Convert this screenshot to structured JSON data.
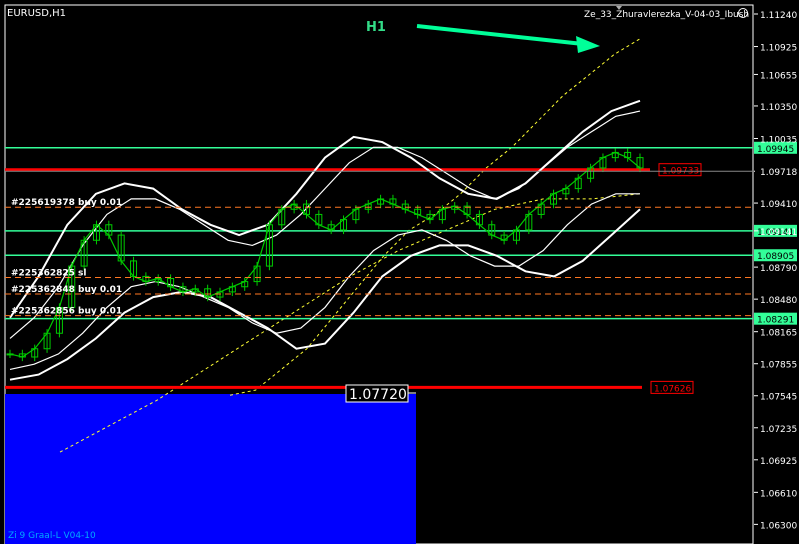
{
  "symbol_label": "EURUSD,H1",
  "indicator_title": "Ze_33_Zhuravlerezka_V-04-03_Ibush",
  "timeframe_annotation": "H1",
  "footer_label": "Zi 9 Graal-L V04-10",
  "crosshair_price": "1.07720",
  "colors": {
    "background": "#000000",
    "candle": "#00cc00",
    "green_level": "#33ff99",
    "red_level": "#ff0000",
    "envelope": "#ffffff",
    "dashed_yellow": "#ffff33",
    "blue_panel": "#0000ff",
    "arrow": "#00ff99",
    "order_line": "#ff7722"
  },
  "chart_data": {
    "type": "line",
    "title": "EURUSD,H1",
    "ylim": [
      1.0611,
      1.1124
    ],
    "y_ticks": [
      "1.11240",
      "1.10925",
      "1.10655",
      "1.10350",
      "1.10035",
      "1.09718",
      "1.09410",
      "1.09141",
      "1.08790",
      "1.08480",
      "1.08165",
      "1.07855",
      "1.07545",
      "1.07235",
      "1.06925",
      "1.06610",
      "1.06300"
    ],
    "current_price": "1.09718",
    "green_levels": [
      {
        "label": "1.09945",
        "value": 1.09945
      },
      {
        "label": "1.09141",
        "value": 1.09141
      },
      {
        "label": "1.08905",
        "value": 1.08905
      },
      {
        "label": "1.08291",
        "value": 1.08291
      }
    ],
    "red_levels": [
      {
        "label": "1.09733",
        "value": 1.09733
      },
      {
        "label": "1.07626",
        "value": 1.07626
      }
    ],
    "order_lines": [
      {
        "label": "#225619378 buy 0.01",
        "value": 1.0937
      },
      {
        "label": "#225362825 sl",
        "value": 1.0869
      },
      {
        "label": "#225362848 buy 0.01",
        "value": 1.0853
      },
      {
        "label": "#225362856 buy 0.01",
        "value": 1.0832
      }
    ],
    "price_series": [
      1.0795,
      1.0792,
      1.08,
      1.0815,
      1.084,
      1.088,
      1.0905,
      1.092,
      1.091,
      1.0885,
      1.087,
      1.0865,
      1.0868,
      1.086,
      1.0855,
      1.0858,
      1.085,
      1.0855,
      1.086,
      1.0865,
      1.088,
      1.092,
      1.0935,
      1.094,
      1.093,
      1.092,
      1.0915,
      1.0925,
      1.0935,
      1.094,
      1.0945,
      1.094,
      1.0935,
      1.093,
      1.0925,
      1.0935,
      1.0938,
      1.093,
      1.092,
      1.091,
      1.0905,
      1.0915,
      1.093,
      1.094,
      1.095,
      1.0955,
      1.0965,
      1.0975,
      1.0985,
      1.099,
      1.0985,
      1.0975
    ],
    "upper_envelope": [
      1.081,
      1.083,
      1.086,
      1.09,
      1.093,
      1.0945,
      1.0945,
      1.0935,
      1.092,
      1.0905,
      1.09,
      1.091,
      1.093,
      1.0955,
      1.098,
      1.0995,
      1.0995,
      1.0985,
      1.097,
      1.0955,
      1.0945,
      1.0955,
      1.0975,
      1.0995,
      1.101,
      1.1025,
      1.103
    ],
    "lower_envelope": [
      1.078,
      1.0785,
      1.0795,
      1.0815,
      1.084,
      1.086,
      1.0865,
      1.086,
      1.085,
      1.084,
      1.0825,
      1.0815,
      1.082,
      1.084,
      1.087,
      1.0895,
      1.091,
      1.0915,
      1.0905,
      1.089,
      1.088,
      1.088,
      1.0895,
      1.092,
      1.094,
      1.095,
      1.095
    ],
    "outer_upper_envelope": [
      1.083,
      1.087,
      1.092,
      1.095,
      1.096,
      1.0955,
      1.0935,
      1.092,
      1.091,
      1.092,
      1.095,
      1.0985,
      1.1005,
      1.1,
      1.0985,
      1.0965,
      1.095,
      1.0945,
      1.096,
      1.0985,
      1.101,
      1.103,
      1.104
    ],
    "outer_lower_envelope": [
      1.077,
      1.0775,
      1.079,
      1.081,
      1.0835,
      1.085,
      1.0855,
      1.085,
      1.0835,
      1.082,
      1.08,
      1.0805,
      1.0835,
      1.087,
      1.089,
      1.09,
      1.09,
      1.089,
      1.0875,
      1.087,
      1.0885,
      1.091,
      1.0935
    ],
    "yellow_dashed_upper": [
      1.0755,
      1.076,
      1.078,
      1.08,
      1.083,
      1.086,
      1.089,
      1.0915,
      1.093,
      1.095,
      1.0975,
      1.0995,
      1.102,
      1.1045,
      1.1065,
      1.1085,
      1.11
    ],
    "yellow_dashed_lower": [
      1.07,
      1.0725,
      1.075,
      1.078,
      1.081,
      1.084,
      1.087,
      1.0895,
      1.0915,
      1.0935,
      1.0945,
      1.0945,
      1.095
    ],
    "grid": false
  }
}
